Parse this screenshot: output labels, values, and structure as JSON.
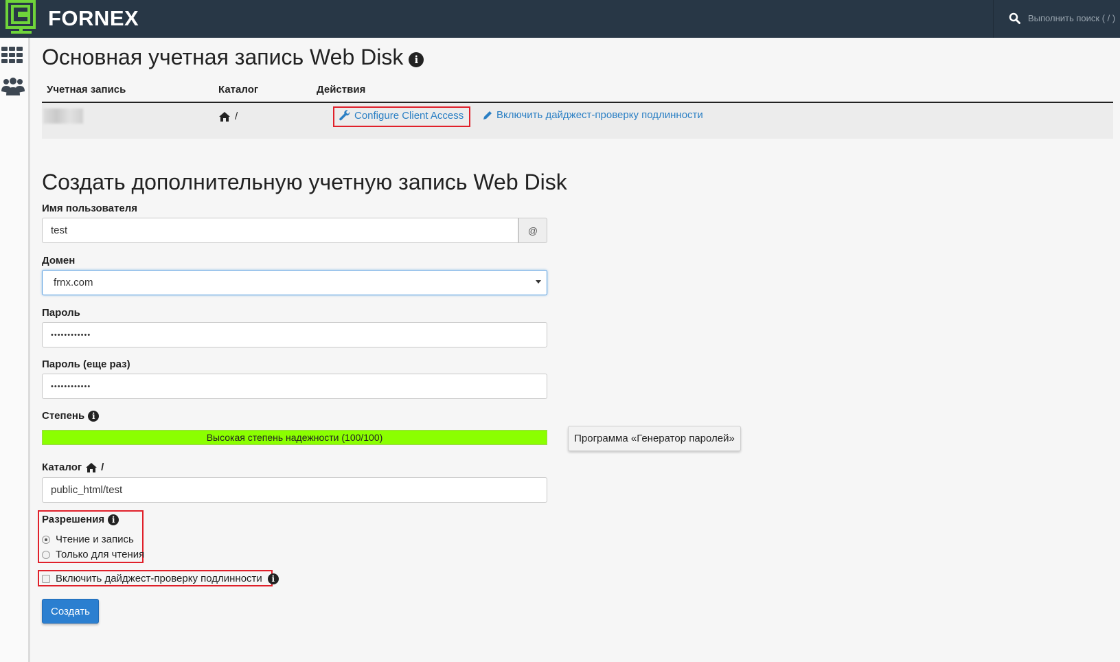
{
  "header": {
    "brand": "FORNEX",
    "search_placeholder": "Выполнить поиск ( / )"
  },
  "sidebar": {
    "items": [
      {
        "name": "apps-grid-icon"
      },
      {
        "name": "users-icon"
      }
    ]
  },
  "primary": {
    "title": "Основная учетная запись Web Disk",
    "columns": [
      "Учетная запись",
      "Каталог",
      "Действия"
    ],
    "row": {
      "directory": "/",
      "actions": [
        "Configure Client Access",
        "Включить дайджест-проверку подлинности"
      ]
    }
  },
  "create": {
    "title": "Создать дополнительную учетную запись Web Disk",
    "username_label": "Имя пользователя",
    "username_value": "test",
    "at_symbol": "@",
    "domain_label": "Домен",
    "domain_value": "frnx.com",
    "password_label": "Пароль",
    "password_value": "••••••••••••",
    "password2_label": "Пароль (еще раз)",
    "password2_value": "••••••••••••",
    "strength_label": "Степень",
    "strength_text": "Высокая степень надежности (100/100)",
    "strength_value": 100,
    "generator_button": "Программа «Генератор паролей»",
    "directory_label": "Каталог",
    "directory_suffix": "/",
    "directory_value": "public_html/test",
    "permissions_label": "Разрешения",
    "permissions_options": [
      "Чтение и запись",
      "Только для чтения"
    ],
    "permissions_selected": 0,
    "digest_label": "Включить дайджест-проверку подлинности",
    "digest_checked": false,
    "submit_label": "Создать"
  },
  "colors": {
    "topbar": "#283746",
    "link": "#2a7fc4",
    "primary_button": "#2b7fd0",
    "strength_bar": "#8bff00",
    "highlight": "#e0202a",
    "logo_green": "#6fd43a"
  }
}
